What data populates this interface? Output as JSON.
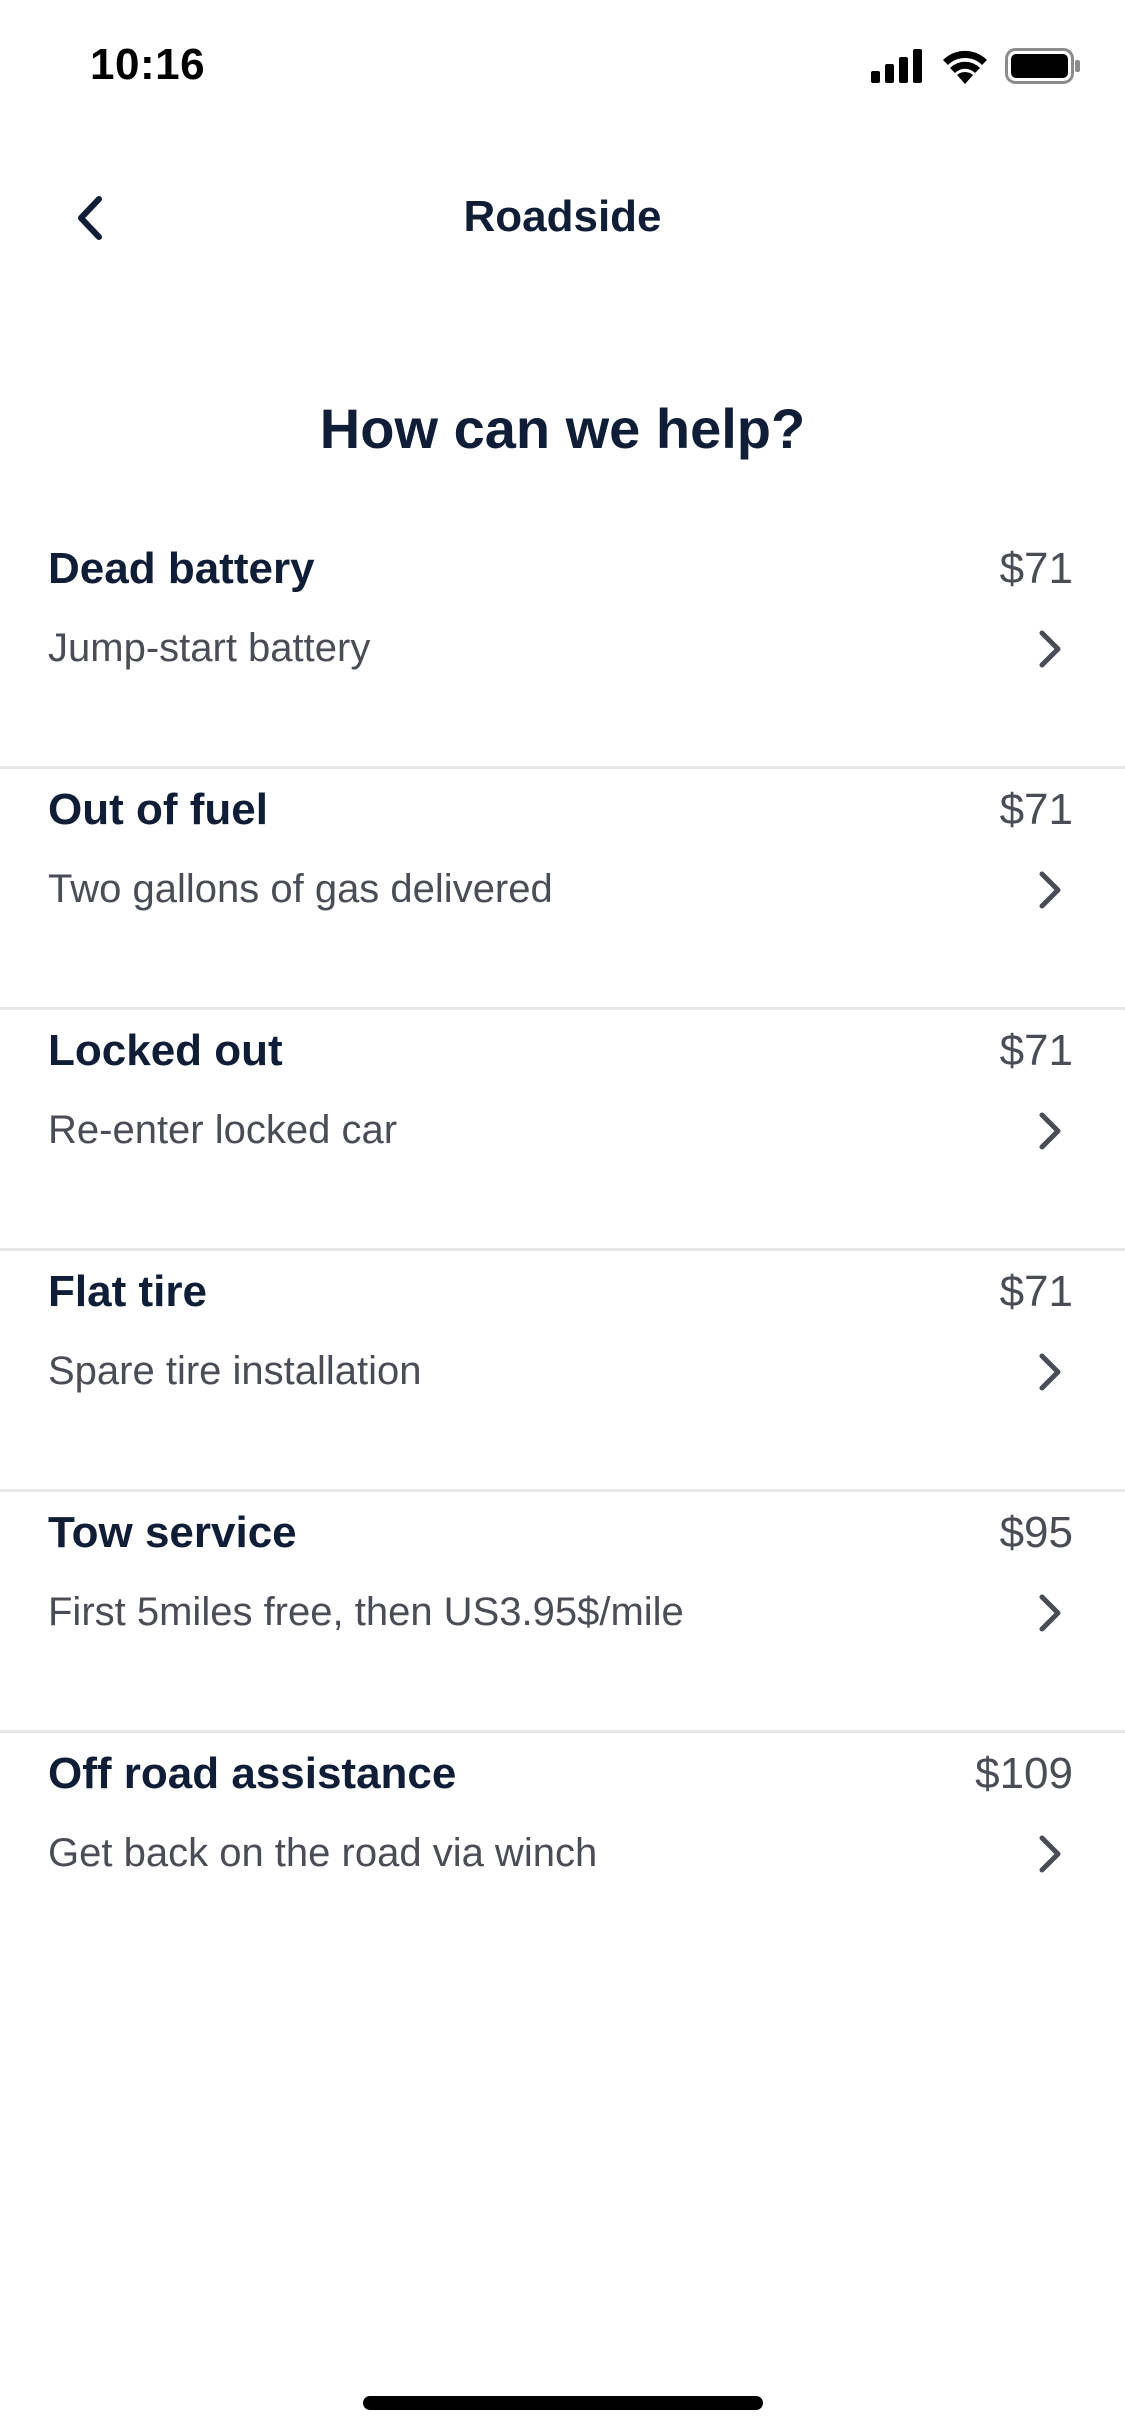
{
  "status_bar": {
    "time": "10:16"
  },
  "nav": {
    "title": "Roadside"
  },
  "heading": "How can we help?",
  "services": [
    {
      "title": "Dead battery",
      "price": "$71",
      "description": "Jump-start battery"
    },
    {
      "title": "Out of fuel",
      "price": "$71",
      "description": "Two gallons of gas delivered"
    },
    {
      "title": "Locked out",
      "price": "$71",
      "description": "Re-enter locked car"
    },
    {
      "title": "Flat tire",
      "price": "$71",
      "description": "Spare tire installation"
    },
    {
      "title": "Tow service",
      "price": "$95",
      "description": "First 5miles free, then US3.95$/mile"
    },
    {
      "title": "Off road assistance",
      "price": "$109",
      "description": "Get back on the road via winch"
    }
  ],
  "icons": {
    "back": "chevron-left-icon",
    "item_arrow": "chevron-right-icon",
    "signal": "cellular-signal-icon",
    "wifi": "wifi-icon",
    "battery": "battery-icon"
  },
  "colors": {
    "primary_text": "#0f1e36",
    "secondary_text": "#4a4d55",
    "divider": "#e6e7ea",
    "background": "#ffffff"
  }
}
